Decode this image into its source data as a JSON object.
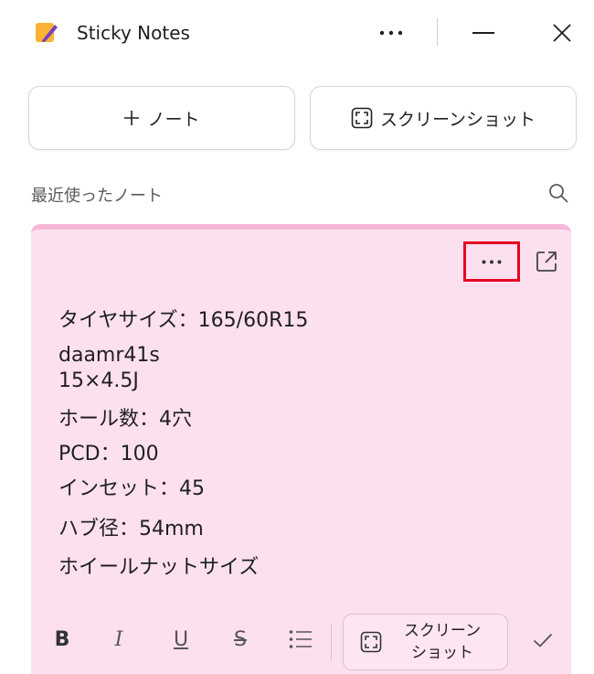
{
  "window": {
    "title": "Sticky Notes",
    "icons": {
      "logo": "sticky-notes-logo",
      "more": "more-horizontal-icon",
      "minimize": "minimize-icon",
      "close": "close-icon"
    }
  },
  "actions": {
    "new_note_label": "ノート",
    "screenshot_label": "スクリーンショット"
  },
  "recent": {
    "label": "最近使ったノート"
  },
  "note": {
    "background_color": "#fde0f0",
    "accent_color": "#f7b7d9",
    "lines": [
      "タイヤサイズ：165/60R15",
      "daamr41s",
      "15×4.5J",
      "ホール数：4穴",
      "PCD：100",
      "インセット：45",
      "ハブ径：54mm",
      "ホイールナットサイズ"
    ],
    "toolbar": {
      "bold": "B",
      "italic": "I",
      "underline": "U",
      "strikethrough": "S",
      "screenshot_line1": "スクリーン",
      "screenshot_line2": "ショット"
    }
  },
  "colors": {
    "highlight_border": "#e6001f",
    "logo_yellow": "#f9b233",
    "logo_purple": "#7b3fc4"
  }
}
